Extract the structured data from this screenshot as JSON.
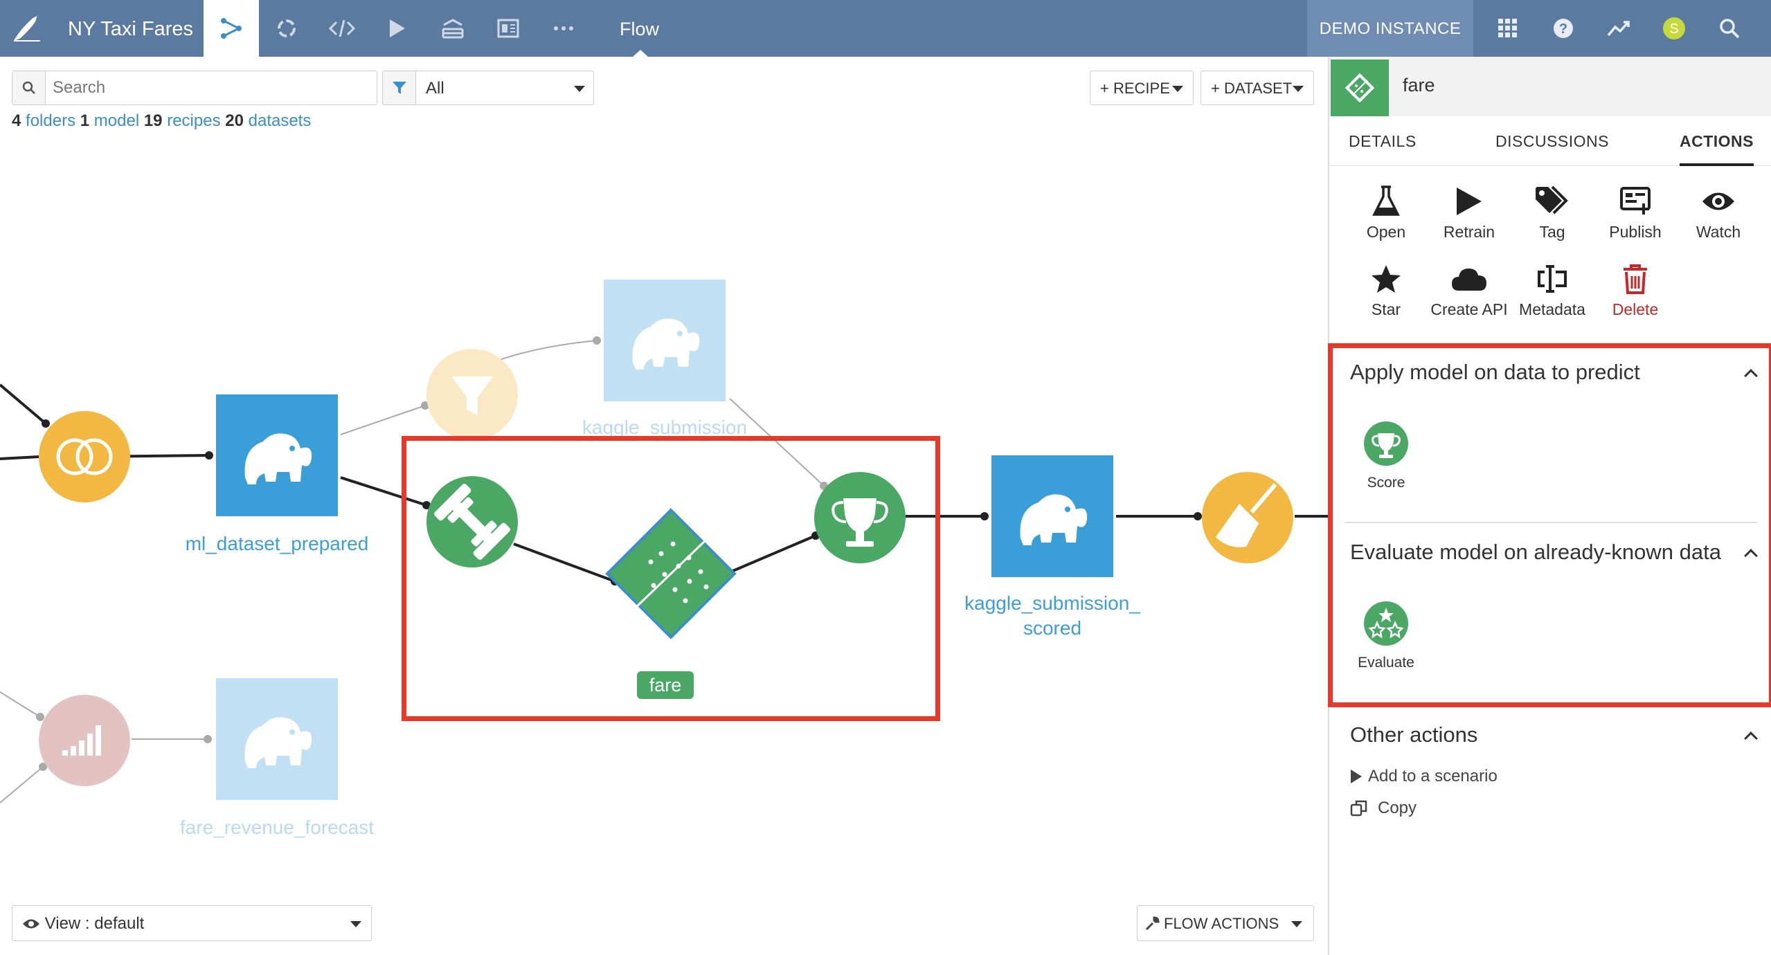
{
  "topbar": {
    "project_name": "NY Taxi Fares",
    "current_view": "Flow",
    "instance_label": "DEMO INSTANCE",
    "user_initial": "S",
    "accent": "#5b7aa0"
  },
  "toolbar": {
    "search_placeholder": "Search",
    "filter_value": "All",
    "recipe_button": "+ RECIPE",
    "dataset_button": "+ DATASET"
  },
  "counts": {
    "folders_n": "4",
    "folders_label": "folders",
    "model_n": "1",
    "model_label": "model",
    "recipes_n": "19",
    "recipes_label": "recipes",
    "datasets_n": "20",
    "datasets_label": "datasets"
  },
  "flow": {
    "ml_dataset": "ml_dataset_prepared",
    "kaggle_submission": "kaggle_submission",
    "scored_line1": "kaggle_submission_",
    "scored_line2": "scored",
    "fare_revenue": "fare_revenue_forecast",
    "model_badge": "fare"
  },
  "bottom": {
    "view_select": "View : default",
    "flow_actions": "FLOW ACTIONS"
  },
  "panel": {
    "title": "fare",
    "tabs": [
      "DETAILS",
      "DISCUSSIONS",
      "ACTIONS"
    ],
    "actions_row1": [
      "Open",
      "Retrain",
      "Tag",
      "Publish",
      "Watch"
    ],
    "actions_row2": [
      "Star",
      "Create API",
      "Metadata",
      "Delete"
    ],
    "apply_title": "Apply model on data to predict",
    "score_label": "Score",
    "evaluate_title": "Evaluate model on already-known data",
    "evaluate_label": "Evaluate",
    "other_title": "Other actions",
    "add_scenario": "Add to a scenario",
    "copy": "Copy"
  }
}
